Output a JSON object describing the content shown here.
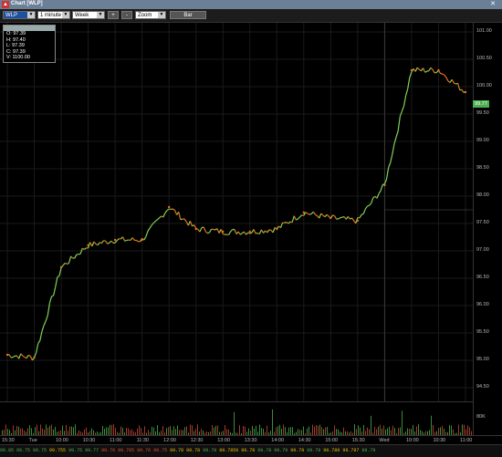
{
  "window": {
    "title": "Chart [WLP]",
    "close_glyph": "✕"
  },
  "toolbar": {
    "symbol": "WLP",
    "interval": "1 minute",
    "range": "Week",
    "plus": "+",
    "minus": "-",
    "zoom": "Zoom",
    "type_button": "Bar"
  },
  "info": {
    "header": "",
    "open": "O: 97.39",
    "high": "H: 97.40",
    "low": "L: 97.39",
    "close": "C: 97.39",
    "volume": "V: 1100.00"
  },
  "price_axis": [
    "101.00",
    "100.50",
    "100.00",
    "99.50",
    "99.00",
    "98.50",
    "98.00",
    "97.50",
    "97.00",
    "96.50",
    "96.00",
    "95.50",
    "95.00",
    "94.50"
  ],
  "last_price": "99.77",
  "volume_axis_label": "80K",
  "time_axis": [
    "15:30",
    "Tue",
    "10:00",
    "10:30",
    "11:00",
    "11:30",
    "12:00",
    "12:30",
    "13:00",
    "13:30",
    "14:00",
    "14:30",
    "15:00",
    "15:30",
    "Wed",
    "10:00",
    "10:30",
    "11:00"
  ],
  "tape": [
    {
      "v": "99.85",
      "c": "#4caf50"
    },
    {
      "v": "99.75",
      "c": "#4caf50"
    },
    {
      "v": "99.75",
      "c": "#4caf50"
    },
    {
      "v": "99.755",
      "c": "#e8c000"
    },
    {
      "v": "99.75",
      "c": "#4caf50"
    },
    {
      "v": "99.77",
      "c": "#4caf50"
    },
    {
      "v": "99.76",
      "c": "#e05030"
    },
    {
      "v": "99.765",
      "c": "#e05030"
    },
    {
      "v": "99.76",
      "c": "#e05030"
    },
    {
      "v": "99.75",
      "c": "#e05030"
    },
    {
      "v": "99.78",
      "c": "#e8c000"
    },
    {
      "v": "99.78",
      "c": "#e8c000"
    },
    {
      "v": "99.78",
      "c": "#4caf50"
    },
    {
      "v": "99.7856",
      "c": "#e8c000"
    },
    {
      "v": "99.78",
      "c": "#e8c000"
    },
    {
      "v": "99.78",
      "c": "#4caf50"
    },
    {
      "v": "99.79",
      "c": "#4caf50"
    },
    {
      "v": "99.79",
      "c": "#e8c000"
    },
    {
      "v": "99.78",
      "c": "#4caf50"
    },
    {
      "v": "99.789",
      "c": "#e8c000"
    },
    {
      "v": "99.797",
      "c": "#e8c000"
    },
    {
      "v": "99.79",
      "c": "#4caf50"
    }
  ],
  "colors": {
    "up": "#7fd35a",
    "down": "#e8741a",
    "last_tag": "#4caf50",
    "grid": "#1a1a1a",
    "titlebar": "#6b7f96"
  },
  "chart_data": {
    "type": "line",
    "title": "",
    "xlabel": "",
    "ylabel": "",
    "ylim": [
      94.5,
      101.0
    ],
    "x": [
      "15:30",
      "Tue",
      "10:00",
      "10:30",
      "11:00",
      "11:30",
      "12:00",
      "12:30",
      "13:00",
      "13:30",
      "14:00",
      "14:30",
      "15:00",
      "15:30",
      "Wed",
      "10:00",
      "10:30",
      "11:00"
    ],
    "series": [
      {
        "name": "",
        "values": [
          95.1,
          95.05,
          96.7,
          97.1,
          97.2,
          97.2,
          97.8,
          97.4,
          97.35,
          97.35,
          97.4,
          97.7,
          97.6,
          97.55,
          98.2,
          100.3,
          100.3,
          99.9
        ]
      }
    ]
  }
}
